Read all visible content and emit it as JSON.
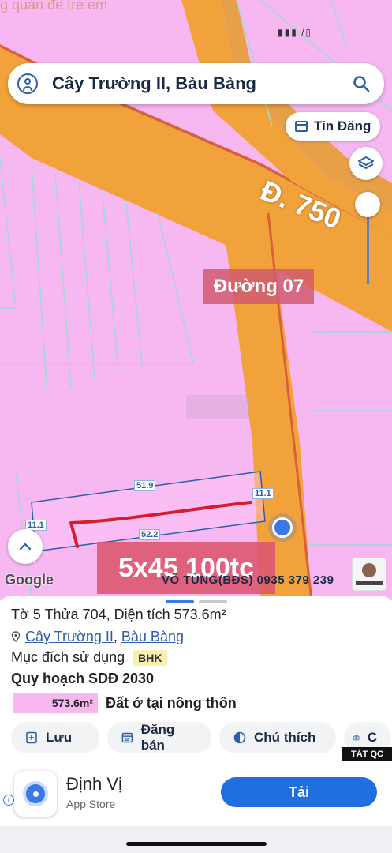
{
  "top_strip_text": "g quản đề trẻ em",
  "status": "▮▮▮ /▯",
  "search": {
    "title": "Cây Trường II, Bàu Bàng"
  },
  "map": {
    "tin_dang": "Tin Đăng",
    "road_750": "Đ. 750",
    "road_07": "Đường 07",
    "dims": {
      "top": "51.9",
      "bottom": "52.2",
      "left": "11.1",
      "right": "11.1"
    },
    "google": "Google",
    "ad_text": "5x45 100tc",
    "watermark": "VÕ TÙNG(BĐS) 0935 379 239"
  },
  "colors": {
    "parcel_pink": "#f7b8f2",
    "road_orange": "#f2a23a",
    "accent_blue": "#1f6fe0"
  },
  "info": {
    "title": "Tờ 5 Thửa 704, Diện tích 573.6m²",
    "addr_part1": "Cây Trường II",
    "addr_sep": ", ",
    "addr_part2": "Bàu Bàng",
    "purpose_label": "Mục đích sử dụng",
    "purpose_badge": "BHK",
    "plan_title": "Quy hoạch SDĐ 2030",
    "plan_area": "573.6m²",
    "plan_desc": "Đất ở tại nông thôn"
  },
  "actions": {
    "save": "Lưu",
    "post": "Đăng bán",
    "note": "Chú thích",
    "cam": "C"
  },
  "ad": {
    "tag": "TẮT QC",
    "app_name": "Định Vị",
    "store": "App Store",
    "download": "Tải"
  },
  "icons": [
    "user-icon",
    "search-icon",
    "calendar-icon",
    "layers-icon",
    "chevron-up-icon",
    "pin-icon",
    "add-note-icon",
    "list-icon",
    "half-circle-icon",
    "camera-icon"
  ]
}
